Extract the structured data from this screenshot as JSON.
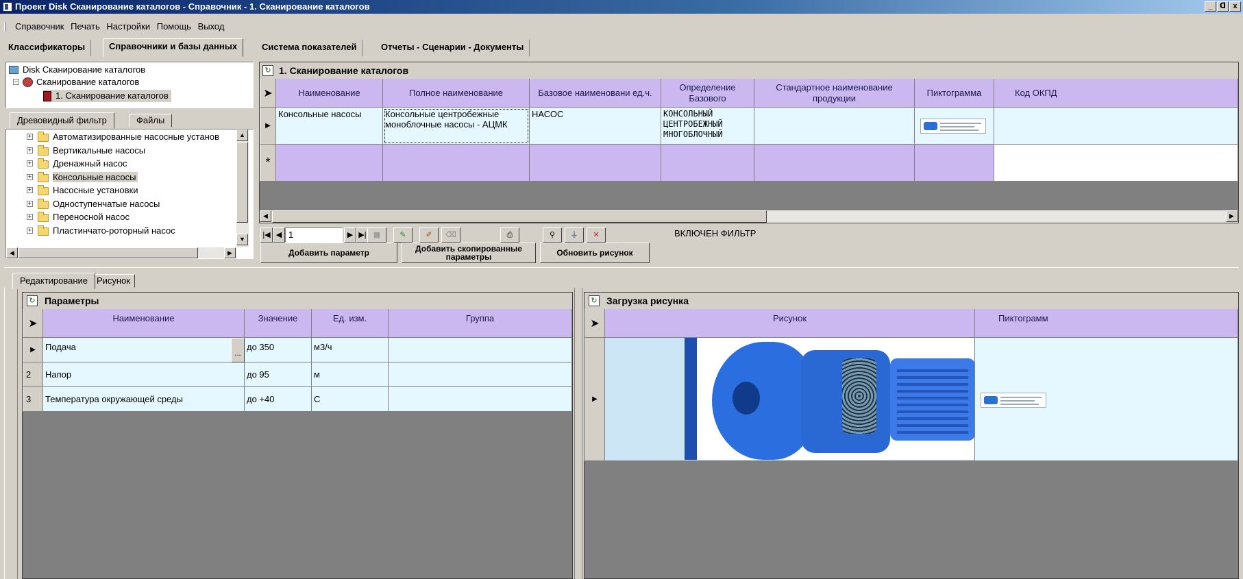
{
  "window": {
    "title": "Проект Disk Сканирование каталогов - Справочник - 1. Сканирование каталогов",
    "controls": {
      "minimize": "_",
      "restore": "ᗡ",
      "close": "x"
    }
  },
  "menu": [
    "Справочник",
    "Печать",
    "Настройки",
    "Помощь",
    "Выход"
  ],
  "top_tabs": [
    "Классификаторы",
    "Справочники и базы данных",
    "Система показателей",
    "Отчеты - Сценарии - Документы"
  ],
  "top_tab_active": "Справочники и базы данных",
  "tree": {
    "root": "Disk Сканирование каталогов",
    "child": "Сканирование каталогов",
    "leaf": "1. Сканирование каталогов"
  },
  "filter_tabs": [
    "Древовидный фильтр",
    "Файлы"
  ],
  "folders": [
    "Автоматизированные насосные установ",
    "Вертикальные насосы",
    "Дренажный насос",
    "Консольные насосы",
    "Насосные установки",
    "Одноступенчатые насосы",
    "Переносной насос",
    "Пластинчато-роторный насос"
  ],
  "selected_folder": "Консольные насосы",
  "catalog": {
    "caption": "1. Сканирование каталогов",
    "columns": [
      "Наименование",
      "Полное наименование",
      "Базовое наименовани ед.ч.",
      "Определение Базового",
      "Стандартное наименование продукции",
      "Пиктограмма",
      "Код ОКПД"
    ],
    "row": {
      "name": "Консольные насосы",
      "full_name": "Консольные центробежные моноблочные насосы - АЦМК",
      "base_name": "НАСОС",
      "definition": "КОНСОЛЬНЫЙ ЦЕНТРОБЕЖНЫЙ МНОГОБЛОЧНЫЙ",
      "std_name": "",
      "code": ""
    },
    "new_row_marker": "*"
  },
  "navigator": {
    "record": "1",
    "filter_status": "ВКЛЮЧЕН ФИЛЬТР"
  },
  "buttons": {
    "add_param": "Добавить параметр",
    "add_copied": "Добавить скопированные параметры",
    "refresh_pic": "Обновить рисунок"
  },
  "bottom_tabs": [
    "Редактирование",
    "Рисунок"
  ],
  "params": {
    "caption": "Параметры",
    "columns": [
      "Наименование",
      "Значение",
      "Ед. изм.",
      "Группа"
    ],
    "rows": [
      {
        "num": "",
        "name": "Подача",
        "value": "до 350",
        "unit": "м3/ч",
        "group": ""
      },
      {
        "num": "2",
        "name": "Напор",
        "value": "до 95",
        "unit": "м",
        "group": ""
      },
      {
        "num": "3",
        "name": "Температура окружающей среды",
        "value": "до +40",
        "unit": "С",
        "group": ""
      }
    ],
    "ellipsis": "..."
  },
  "picture": {
    "caption": "Загрузка рисунка",
    "columns": [
      "Рисунок",
      "Пиктограмм"
    ]
  },
  "colors": {
    "header": "#ccb8f0",
    "row": "#e6f8ff",
    "new_row": "#ccb8f0",
    "title_start": "#0a246a",
    "pump_blue": "#1f5fd0"
  }
}
